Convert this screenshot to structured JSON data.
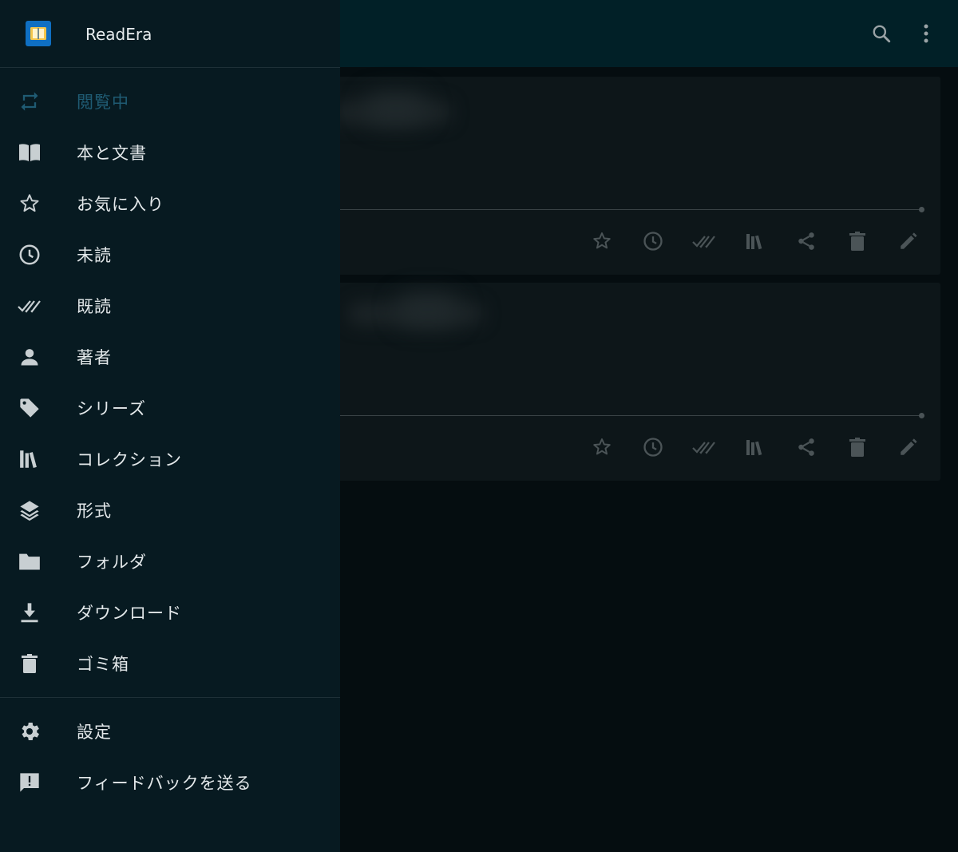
{
  "app": {
    "name": "ReadEra"
  },
  "drawer": {
    "items": [
      {
        "label": "閲覧中",
        "icon": "repeat-icon",
        "active": true
      },
      {
        "label": "本と文書",
        "icon": "book-open-icon"
      },
      {
        "label": "お気に入り",
        "icon": "star-icon"
      },
      {
        "label": "未読",
        "icon": "clock-icon"
      },
      {
        "label": "既読",
        "icon": "double-check-icon"
      },
      {
        "label": "著者",
        "icon": "person-icon"
      },
      {
        "label": "シリーズ",
        "icon": "tag-icon"
      },
      {
        "label": "コレクション",
        "icon": "books-shelf-icon"
      },
      {
        "label": "形式",
        "icon": "layers-icon"
      },
      {
        "label": "フォルダ",
        "icon": "folder-icon"
      },
      {
        "label": "ダウンロード",
        "icon": "download-icon"
      },
      {
        "label": "ゴミ箱",
        "icon": "trash-icon"
      }
    ],
    "bottom_items": [
      {
        "label": "設定",
        "icon": "gear-icon"
      },
      {
        "label": "フィードバックを送る",
        "icon": "feedback-icon"
      }
    ]
  },
  "colors": {
    "drawer_bg": "#071a21",
    "appbar_bg": "#012027",
    "active_label": "#1f5b73",
    "icon": "#c8cfd2"
  }
}
